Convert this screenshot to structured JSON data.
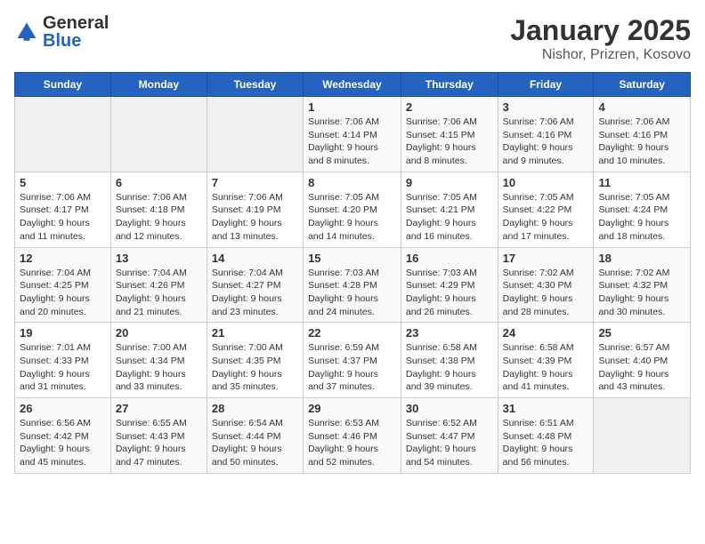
{
  "header": {
    "logo": {
      "general": "General",
      "blue": "Blue"
    },
    "title": "January 2025",
    "subtitle": "Nishor, Prizren, Kosovo"
  },
  "weekdays": [
    "Sunday",
    "Monday",
    "Tuesday",
    "Wednesday",
    "Thursday",
    "Friday",
    "Saturday"
  ],
  "weeks": [
    [
      {
        "day": "",
        "details": ""
      },
      {
        "day": "",
        "details": ""
      },
      {
        "day": "",
        "details": ""
      },
      {
        "day": "1",
        "details": "Sunrise: 7:06 AM\nSunset: 4:14 PM\nDaylight: 9 hours and 8 minutes."
      },
      {
        "day": "2",
        "details": "Sunrise: 7:06 AM\nSunset: 4:15 PM\nDaylight: 9 hours and 8 minutes."
      },
      {
        "day": "3",
        "details": "Sunrise: 7:06 AM\nSunset: 4:16 PM\nDaylight: 9 hours and 9 minutes."
      },
      {
        "day": "4",
        "details": "Sunrise: 7:06 AM\nSunset: 4:16 PM\nDaylight: 9 hours and 10 minutes."
      }
    ],
    [
      {
        "day": "5",
        "details": "Sunrise: 7:06 AM\nSunset: 4:17 PM\nDaylight: 9 hours and 11 minutes."
      },
      {
        "day": "6",
        "details": "Sunrise: 7:06 AM\nSunset: 4:18 PM\nDaylight: 9 hours and 12 minutes."
      },
      {
        "day": "7",
        "details": "Sunrise: 7:06 AM\nSunset: 4:19 PM\nDaylight: 9 hours and 13 minutes."
      },
      {
        "day": "8",
        "details": "Sunrise: 7:05 AM\nSunset: 4:20 PM\nDaylight: 9 hours and 14 minutes."
      },
      {
        "day": "9",
        "details": "Sunrise: 7:05 AM\nSunset: 4:21 PM\nDaylight: 9 hours and 16 minutes."
      },
      {
        "day": "10",
        "details": "Sunrise: 7:05 AM\nSunset: 4:22 PM\nDaylight: 9 hours and 17 minutes."
      },
      {
        "day": "11",
        "details": "Sunrise: 7:05 AM\nSunset: 4:24 PM\nDaylight: 9 hours and 18 minutes."
      }
    ],
    [
      {
        "day": "12",
        "details": "Sunrise: 7:04 AM\nSunset: 4:25 PM\nDaylight: 9 hours and 20 minutes."
      },
      {
        "day": "13",
        "details": "Sunrise: 7:04 AM\nSunset: 4:26 PM\nDaylight: 9 hours and 21 minutes."
      },
      {
        "day": "14",
        "details": "Sunrise: 7:04 AM\nSunset: 4:27 PM\nDaylight: 9 hours and 23 minutes."
      },
      {
        "day": "15",
        "details": "Sunrise: 7:03 AM\nSunset: 4:28 PM\nDaylight: 9 hours and 24 minutes."
      },
      {
        "day": "16",
        "details": "Sunrise: 7:03 AM\nSunset: 4:29 PM\nDaylight: 9 hours and 26 minutes."
      },
      {
        "day": "17",
        "details": "Sunrise: 7:02 AM\nSunset: 4:30 PM\nDaylight: 9 hours and 28 minutes."
      },
      {
        "day": "18",
        "details": "Sunrise: 7:02 AM\nSunset: 4:32 PM\nDaylight: 9 hours and 30 minutes."
      }
    ],
    [
      {
        "day": "19",
        "details": "Sunrise: 7:01 AM\nSunset: 4:33 PM\nDaylight: 9 hours and 31 minutes."
      },
      {
        "day": "20",
        "details": "Sunrise: 7:00 AM\nSunset: 4:34 PM\nDaylight: 9 hours and 33 minutes."
      },
      {
        "day": "21",
        "details": "Sunrise: 7:00 AM\nSunset: 4:35 PM\nDaylight: 9 hours and 35 minutes."
      },
      {
        "day": "22",
        "details": "Sunrise: 6:59 AM\nSunset: 4:37 PM\nDaylight: 9 hours and 37 minutes."
      },
      {
        "day": "23",
        "details": "Sunrise: 6:58 AM\nSunset: 4:38 PM\nDaylight: 9 hours and 39 minutes."
      },
      {
        "day": "24",
        "details": "Sunrise: 6:58 AM\nSunset: 4:39 PM\nDaylight: 9 hours and 41 minutes."
      },
      {
        "day": "25",
        "details": "Sunrise: 6:57 AM\nSunset: 4:40 PM\nDaylight: 9 hours and 43 minutes."
      }
    ],
    [
      {
        "day": "26",
        "details": "Sunrise: 6:56 AM\nSunset: 4:42 PM\nDaylight: 9 hours and 45 minutes."
      },
      {
        "day": "27",
        "details": "Sunrise: 6:55 AM\nSunset: 4:43 PM\nDaylight: 9 hours and 47 minutes."
      },
      {
        "day": "28",
        "details": "Sunrise: 6:54 AM\nSunset: 4:44 PM\nDaylight: 9 hours and 50 minutes."
      },
      {
        "day": "29",
        "details": "Sunrise: 6:53 AM\nSunset: 4:46 PM\nDaylight: 9 hours and 52 minutes."
      },
      {
        "day": "30",
        "details": "Sunrise: 6:52 AM\nSunset: 4:47 PM\nDaylight: 9 hours and 54 minutes."
      },
      {
        "day": "31",
        "details": "Sunrise: 6:51 AM\nSunset: 4:48 PM\nDaylight: 9 hours and 56 minutes."
      },
      {
        "day": "",
        "details": ""
      }
    ]
  ]
}
